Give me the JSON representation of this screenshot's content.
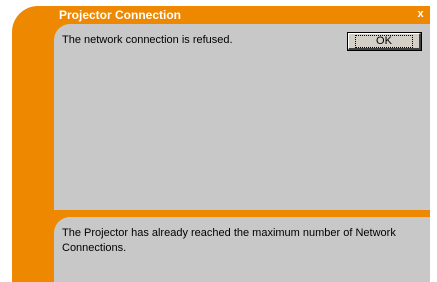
{
  "window": {
    "title": "Projector Connection",
    "close_label": "x"
  },
  "dialog": {
    "message": "The network connection is refused.",
    "ok_label": "OK",
    "detail": "The Projector has already reached the maximum number of Network Connections."
  },
  "colors": {
    "accent": "#ee8800",
    "panel": "#c8c8c8"
  }
}
